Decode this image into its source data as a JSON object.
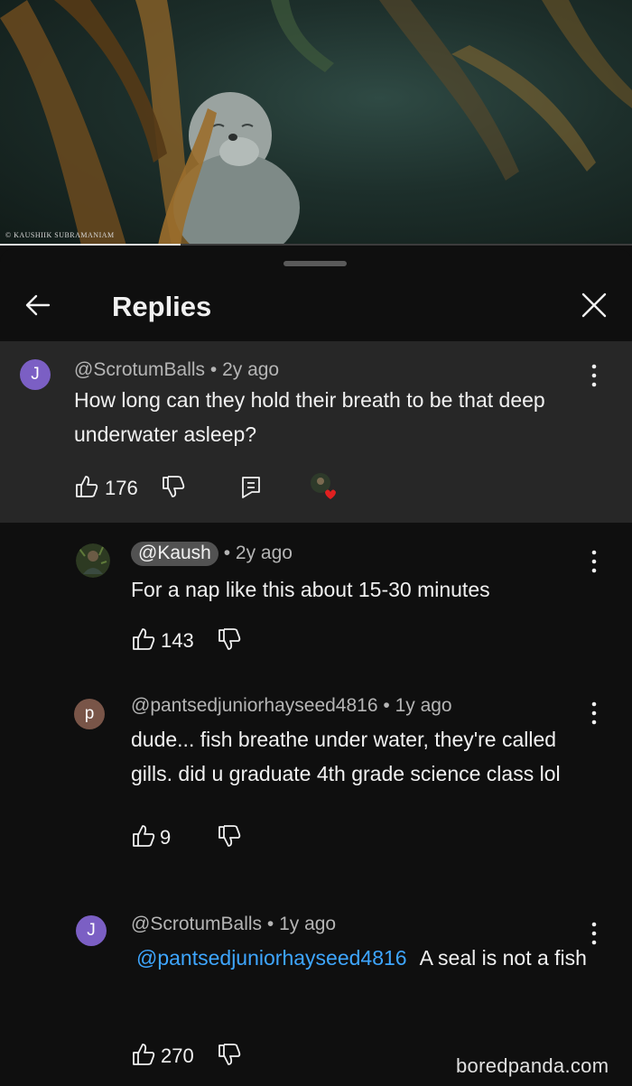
{
  "video": {
    "watermark": "© KAUSHIIK SUBRAMANIAM",
    "progress": 0.285,
    "subject": "seal sleeping underwater among kelp"
  },
  "sheet": {
    "title": "Replies"
  },
  "icons": {
    "back": "arrow-left-icon",
    "close": "close-icon",
    "more": "more-vertical-icon",
    "like": "thumbs-up-icon",
    "dislike": "thumbs-down-icon",
    "reply": "reply-icon"
  },
  "comments": [
    {
      "avatar_letter": "J",
      "avatar_color": "#7b5fc4",
      "author": "@ScrotumBalls",
      "age": "2y ago",
      "text": "How long can they hold their breath to be that deep underwater asleep?",
      "likes": "176"
    },
    {
      "avatar_letter": "",
      "author": "@Kaush",
      "age": "2y ago",
      "text": "For a nap like this about 15-30 minutes",
      "likes": "143"
    },
    {
      "avatar_letter": "p",
      "avatar_color": "#795548",
      "author": "@pantsedjuniorhayseed4816",
      "age": "1y ago",
      "text": "dude... fish breathe under water, they're called gills. did u graduate 4th grade science class lol",
      "likes": "9"
    },
    {
      "avatar_letter": "J",
      "avatar_color": "#7b5fc4",
      "author": "@ScrotumBalls",
      "age": "1y ago",
      "mention": "@pantsedjuniorhayseed4816",
      "text": "A seal is not a fish",
      "likes": "270"
    }
  ],
  "brand": "boredpanda.com",
  "separator": "•"
}
